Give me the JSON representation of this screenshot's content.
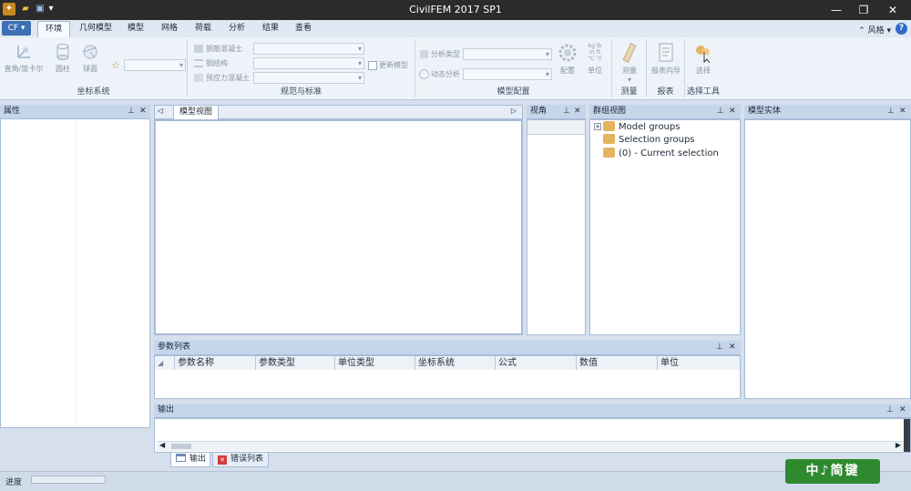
{
  "app": {
    "title": "CivilFEM 2017 SP1"
  },
  "quick_access": {
    "icons": [
      "app-logo-icon",
      "open-folder-icon",
      "save-icon",
      "dropdown-icon"
    ]
  },
  "menu_button": {
    "label": "CF ▾"
  },
  "tabs": [
    "环境",
    "几何模型",
    "模型",
    "网格",
    "荷载",
    "分析",
    "结果",
    "查看"
  ],
  "active_tab": 0,
  "style_menu": {
    "label": "风格"
  },
  "ribbon": {
    "coords": {
      "label": "坐标系统",
      "buttons": [
        "直角/笛卡尔",
        "圆柱",
        "球面"
      ]
    },
    "norms": {
      "label": "规范与标准",
      "rows": [
        "钢筋混凝土",
        "钢结构",
        "预应力混凝土"
      ],
      "checkbox": "更新模型"
    },
    "model_config": {
      "label": "模型配置",
      "rows": [
        "分析类型",
        "动态分析"
      ],
      "buttons": [
        "配置",
        "单位"
      ],
      "unit_glyph": [
        "kg",
        "m",
        "lb",
        "ft",
        "°C",
        "°F"
      ]
    },
    "measure": {
      "label": "测量",
      "button": "测量"
    },
    "report": {
      "label": "报表",
      "button": "报表向导"
    },
    "select_tools": {
      "label": "选择工具",
      "button": "选择"
    }
  },
  "panels": {
    "properties": {
      "title": "属性"
    },
    "model_view": {
      "tab": "模型视图"
    },
    "view_angle": {
      "title": "视角"
    },
    "group_view": {
      "title": "群组视图",
      "items": [
        "Model groups",
        "Selection groups",
        "(0) - Current selection"
      ]
    },
    "model_entities": {
      "title": "模型实体"
    },
    "parameters": {
      "title": "参数列表",
      "columns": [
        "参数名称",
        "参数类型",
        "单位类型",
        "坐标系统",
        "公式",
        "数值",
        "单位"
      ]
    },
    "output": {
      "title": "输出",
      "tabs": [
        "输出",
        "错误列表"
      ]
    }
  },
  "status": {
    "label": "进度"
  },
  "watermark": {
    "text": "中♪简键"
  },
  "colors": {
    "title_bar": "#2b2b2b",
    "accent": "#3d6fb3",
    "panel_header": "#c5d5ea",
    "watermark_bg": "#2f8a2f"
  }
}
